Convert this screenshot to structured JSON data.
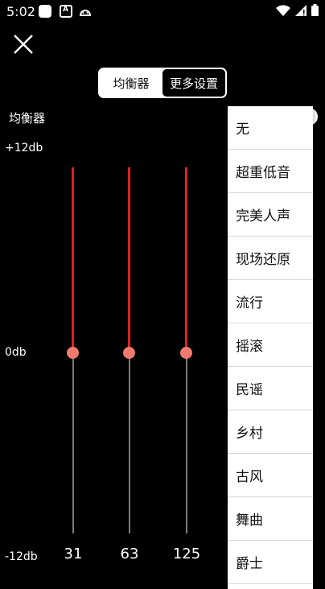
{
  "status_bar": {
    "time": "5:02"
  },
  "header": {
    "tabs": [
      {
        "label": "均衡器",
        "active": false
      },
      {
        "label": "更多设置",
        "active": true
      }
    ]
  },
  "equalizer": {
    "label": "均衡器",
    "db_max": "+12db",
    "db_zero": "0db",
    "db_min": "-12db",
    "bands": [
      {
        "freq": "31",
        "gain_db": 0
      },
      {
        "freq": "63",
        "gain_db": 0
      },
      {
        "freq": "125",
        "gain_db": 0
      }
    ]
  },
  "preset_dropdown": {
    "options": [
      "无",
      "超重低音",
      "完美人声",
      "现场还原",
      "流行",
      "摇滚",
      "民谣",
      "乡村",
      "古风",
      "舞曲",
      "爵士"
    ]
  },
  "colors": {
    "track_active": "#e02020",
    "thumb": "#f07a6e",
    "track_inactive": "#7a7a7a"
  }
}
